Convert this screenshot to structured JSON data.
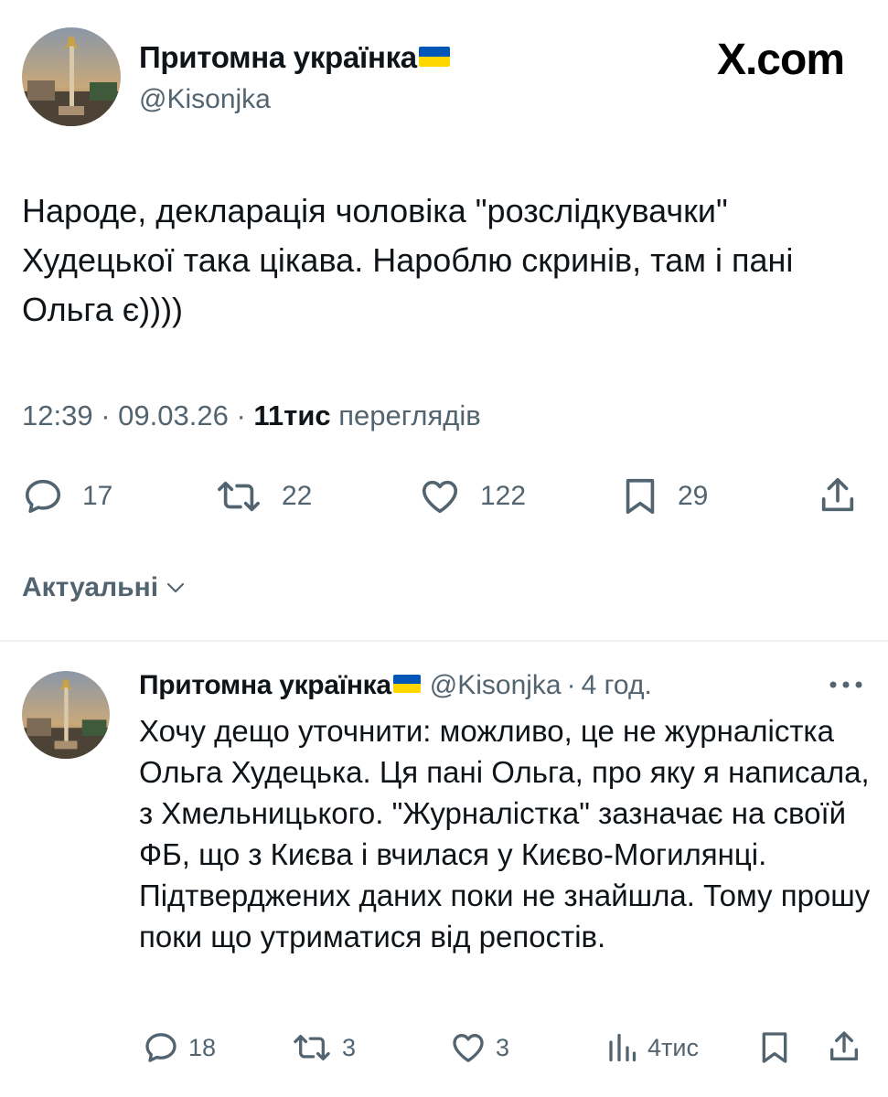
{
  "header": {
    "author_name": "Притомна українка",
    "author_handle": "@Kisonjka",
    "site_logo": "X.com"
  },
  "tweet": {
    "text": "Народе, декларація чоловіка \"розслідкувачки\" Худецької така цікава. Нароблю скринів, там і пані Ольга є))))",
    "time": "12:39",
    "date": "09.03.26",
    "views_count": "11тис",
    "views_label": "переглядів",
    "actions": {
      "replies": "17",
      "reposts": "22",
      "likes": "122",
      "bookmarks": "29"
    }
  },
  "sort": {
    "label": "Актуальні"
  },
  "reply": {
    "author_name": "Притомна українка",
    "author_handle": "@Kisonjka",
    "separator": "·",
    "time": "4 год.",
    "text": "Хочу дещо уточнити: можливо, це не журналістка Ольга Худецька. Ця пані Ольга, про яку я написала, з Хмельницького. \"Журналістка\" зазначає на своїй ФБ, що з Києва і вчилася у Києво-Могилянці. Підтверджених даних поки не знайшла. Тому прошу поки що утриматися від репостів.",
    "actions": {
      "replies": "18",
      "reposts": "3",
      "likes": "3",
      "views": "4тис"
    }
  },
  "colors": {
    "text": "#0f1419",
    "secondary": "#536471",
    "flag_blue": "#0057b7",
    "flag_yellow": "#ffd700",
    "divider": "#eff3f4"
  },
  "icons": [
    "reply-icon",
    "repost-icon",
    "like-icon",
    "bookmark-icon",
    "share-icon",
    "views-icon",
    "more-icon",
    "chevron-down-icon"
  ]
}
